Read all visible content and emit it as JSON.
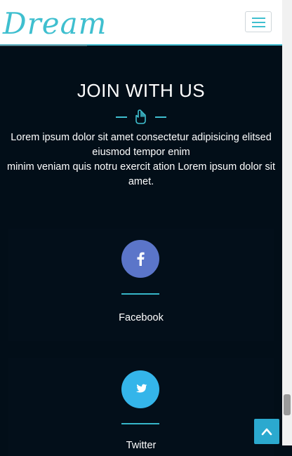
{
  "brand": {
    "logo_text": "Dream",
    "accent_color": "#3fbfcf"
  },
  "navbar": {
    "menu_toggle_icon": "hamburger-menu-icon"
  },
  "section": {
    "title": "JOIN WITH US",
    "ornament_icon": "pointing-hand-icon",
    "description_line1": "Lorem ipsum dolor sit amet consectetur adipisicing elitsed eiusmod tempor enim",
    "description_line2": "minim veniam quis notru exercit ation Lorem ipsum dolor sit amet."
  },
  "social": [
    {
      "label": "Facebook",
      "icon": "facebook-icon",
      "color": "#5b75c9"
    },
    {
      "label": "Twitter",
      "icon": "twitter-icon",
      "color": "#34b5ea"
    }
  ],
  "scroll_top": {
    "icon": "chevron-up-icon",
    "color": "#2ba9cf"
  }
}
